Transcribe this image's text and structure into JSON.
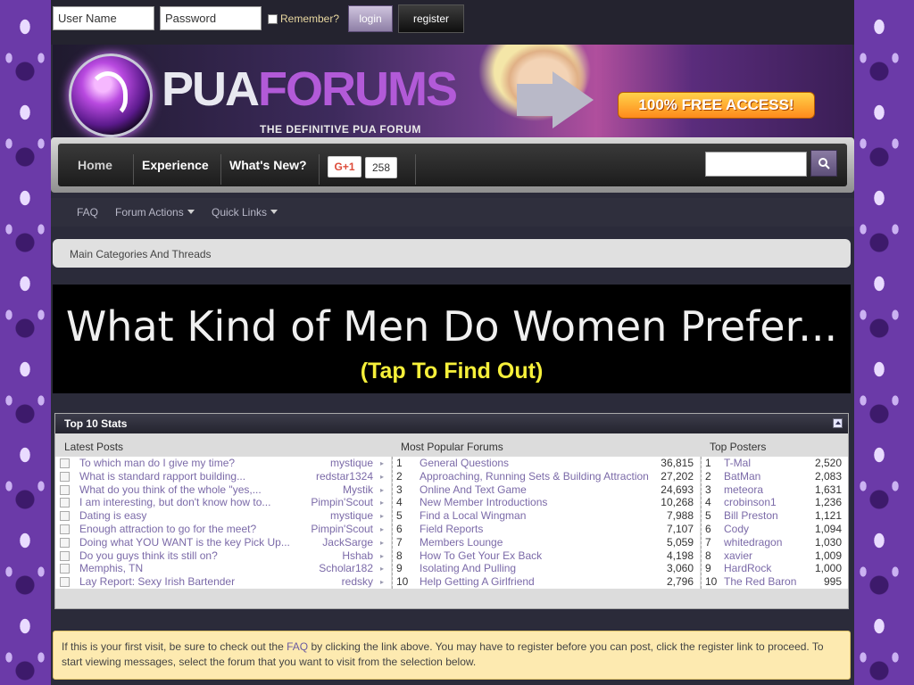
{
  "login": {
    "username_placeholder": "User Name",
    "password_placeholder": "Password",
    "remember_label": "Remember?",
    "login_label": "login",
    "register_label": "register"
  },
  "banner": {
    "logo_part1": "PUA",
    "logo_part2": "FORUMS",
    "tagline": "THE DEFINITIVE PUA FORUM",
    "free_access": "100% FREE ACCESS!"
  },
  "nav": {
    "home": "Home",
    "experience": "Experience",
    "whats_new": "What's New?",
    "gplus_label": "G+1",
    "gplus_count": "258"
  },
  "subnav": {
    "faq": "FAQ",
    "forum_actions": "Forum Actions",
    "quick_links": "Quick Links"
  },
  "breadcrumb": "Main Categories And Threads",
  "ad": {
    "headline": "What Kind of Men Do Women Prefer...",
    "cta": "(Tap To Find Out)"
  },
  "stats": {
    "title": "Top 10 Stats",
    "latest_header": "Latest Posts",
    "forums_header": "Most Popular Forums",
    "posters_header": "Top Posters",
    "latest_posts": [
      {
        "title": "To which man do I give my time?",
        "user": "mystique"
      },
      {
        "title": "What is standard rapport building...",
        "user": "redstar1324"
      },
      {
        "title": "What do you think of the whole \"yes,...",
        "user": "Mystik"
      },
      {
        "title": "I am interesting, but don't know how to...",
        "user": "Pimpin'Scout"
      },
      {
        "title": "Dating is easy",
        "user": "mystique"
      },
      {
        "title": "Enough attraction to go for the meet?",
        "user": "Pimpin'Scout"
      },
      {
        "title": "Doing what YOU WANT is the key Pick Up...",
        "user": "JackSarge"
      },
      {
        "title": "Do you guys think its still on?",
        "user": "Hshab"
      },
      {
        "title": "Memphis, TN",
        "user": "Scholar182"
      },
      {
        "title": "Lay Report: Sexy Irish Bartender",
        "user": "redsky"
      }
    ],
    "popular_forums": [
      {
        "rank": "1",
        "name": "General Questions",
        "count": "36,815"
      },
      {
        "rank": "2",
        "name": "Approaching, Running Sets & Building Attraction",
        "count": "27,202"
      },
      {
        "rank": "3",
        "name": "Online And Text Game",
        "count": "24,693"
      },
      {
        "rank": "4",
        "name": "New Member Introductions",
        "count": "10,268"
      },
      {
        "rank": "5",
        "name": "Find a Local Wingman",
        "count": "7,988"
      },
      {
        "rank": "6",
        "name": "Field Reports",
        "count": "7,107"
      },
      {
        "rank": "7",
        "name": "Members Lounge",
        "count": "5,059"
      },
      {
        "rank": "8",
        "name": "How To Get Your Ex Back",
        "count": "4,198"
      },
      {
        "rank": "9",
        "name": "Isolating And Pulling",
        "count": "3,060"
      },
      {
        "rank": "10",
        "name": "Help Getting A Girlfriend",
        "count": "2,796"
      }
    ],
    "top_posters": [
      {
        "rank": "1",
        "name": "T-Mal",
        "count": "2,520"
      },
      {
        "rank": "2",
        "name": "BatMan",
        "count": "2,083"
      },
      {
        "rank": "3",
        "name": "meteora",
        "count": "1,631"
      },
      {
        "rank": "4",
        "name": "crobinson1",
        "count": "1,236"
      },
      {
        "rank": "5",
        "name": "Bill Preston",
        "count": "1,121"
      },
      {
        "rank": "6",
        "name": "Cody",
        "count": "1,094"
      },
      {
        "rank": "7",
        "name": "whitedragon",
        "count": "1,030"
      },
      {
        "rank": "8",
        "name": "xavier",
        "count": "1,009"
      },
      {
        "rank": "9",
        "name": "HardRock",
        "count": "1,000"
      },
      {
        "rank": "10",
        "name": "The Red Baron",
        "count": "995"
      }
    ]
  },
  "notice": {
    "part1": "If this is your first visit, be sure to check out the ",
    "faq_link": "FAQ",
    "part2": " by clicking the link above. You may have to register before you can post, click the register link to proceed. To start viewing messages, select the forum that you want to visit from the selection below."
  },
  "colors": {
    "accent": "#7b6aa8",
    "banner_orange": "#ff8a1c",
    "notice_bg": "#fdeab0"
  }
}
